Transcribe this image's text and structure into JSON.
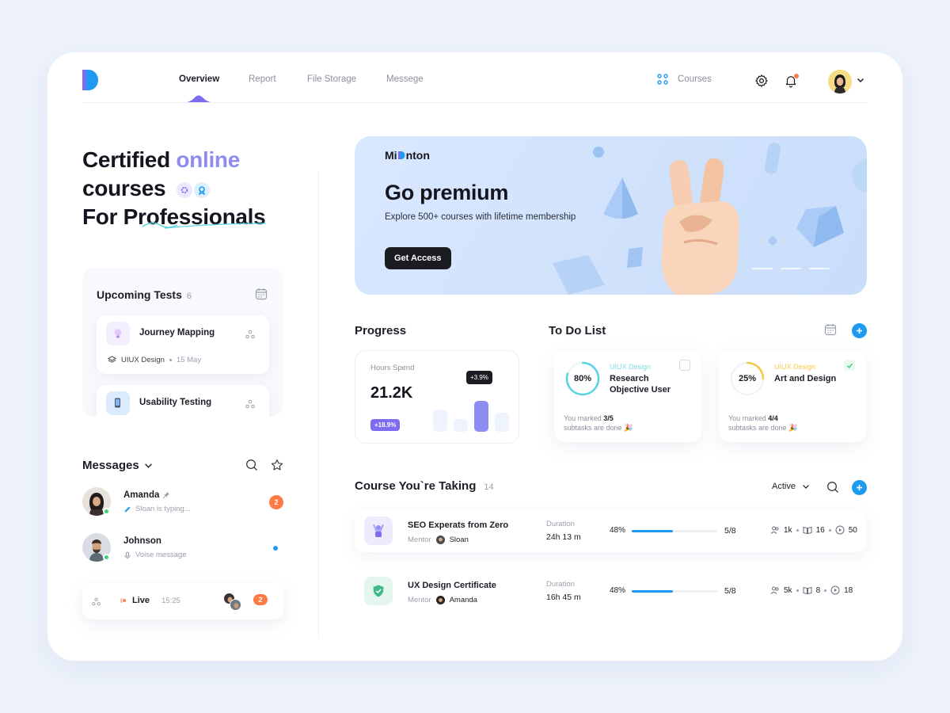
{
  "nav": {
    "items": [
      {
        "label": "Overview",
        "active": true
      },
      {
        "label": "Report",
        "active": false
      },
      {
        "label": "File Storage",
        "active": false
      },
      {
        "label": "Messege",
        "active": false
      }
    ],
    "courses_link": "Courses",
    "icons": [
      "logo-icon",
      "grid-icon",
      "gear-icon",
      "bell-icon",
      "chevron-down-icon"
    ]
  },
  "hero": {
    "line1_a": "Certified ",
    "line1_b": "online",
    "line2": "courses",
    "line3": "For Professionals"
  },
  "upcoming_tests": {
    "title": "Upcoming Tests",
    "count": "6",
    "items": [
      {
        "name": "Journey Mapping",
        "category": "UIUX Design",
        "date": "15 May"
      },
      {
        "name": "Usability Testing"
      }
    ]
  },
  "messages": {
    "title": "Messages",
    "items": [
      {
        "name": "Amanda",
        "status": "Sloan is typing...",
        "unread": "2"
      },
      {
        "name": "Johnson",
        "status": "Voise message"
      }
    ],
    "live": {
      "label": "Live",
      "time": "15:25",
      "unread": "2"
    }
  },
  "banner": {
    "brand": "Minton",
    "brand_pre": "Mi",
    "brand_post": "nton",
    "title": "Go premium",
    "subtitle": "Explore 500+ courses with lifetime membership",
    "button": "Get Access"
  },
  "progress": {
    "title": "Progress",
    "label": "Hours Spend",
    "value": "21.2K",
    "change": "+18.9%",
    "bar_tip": "+3.9%",
    "bars": [
      0.55,
      0.32,
      0.78,
      0.48
    ],
    "highlight_index": 2
  },
  "todo": {
    "title": "To Do List",
    "items": [
      {
        "percent": "80%",
        "progress": 0.8,
        "category": "UIUX Design",
        "name": "Research Objective User",
        "note_pre": "You marked ",
        "note_count": "3/5",
        "note_post": "subtasks are done 🎉",
        "checked": false,
        "color": "#59d3e3"
      },
      {
        "percent": "25%",
        "progress": 0.25,
        "category": "UIUX Design",
        "name": "Art and Design",
        "note_pre": "You marked ",
        "note_count": "4/4",
        "note_post": "subtasks are done 🎉",
        "checked": true,
        "color": "#f5c94a"
      }
    ]
  },
  "courses": {
    "title": "Course You`re Taking",
    "count": "14",
    "filter": "Active",
    "rows": [
      {
        "name": "SEO Experats from Zero",
        "mentor_label": "Mentor",
        "mentor": "Sloan",
        "duration_label": "Duration",
        "duration": "24h 13 m",
        "percent": "48%",
        "progress": 0.48,
        "fraction": "5/8",
        "students": "1k",
        "lessons": "16",
        "videos": "50"
      },
      {
        "name": "UX Design Certificate",
        "mentor_label": "Mentor",
        "mentor": "Amanda",
        "duration_label": "Duration",
        "duration": "16h 45 m",
        "percent": "48%",
        "progress": 0.48,
        "fraction": "5/8",
        "students": "5k",
        "lessons": "8",
        "videos": "18"
      }
    ]
  },
  "colors": {
    "accent": "#1e9bf0",
    "purple": "#8e8cf2",
    "orange": "#ff7a45"
  }
}
